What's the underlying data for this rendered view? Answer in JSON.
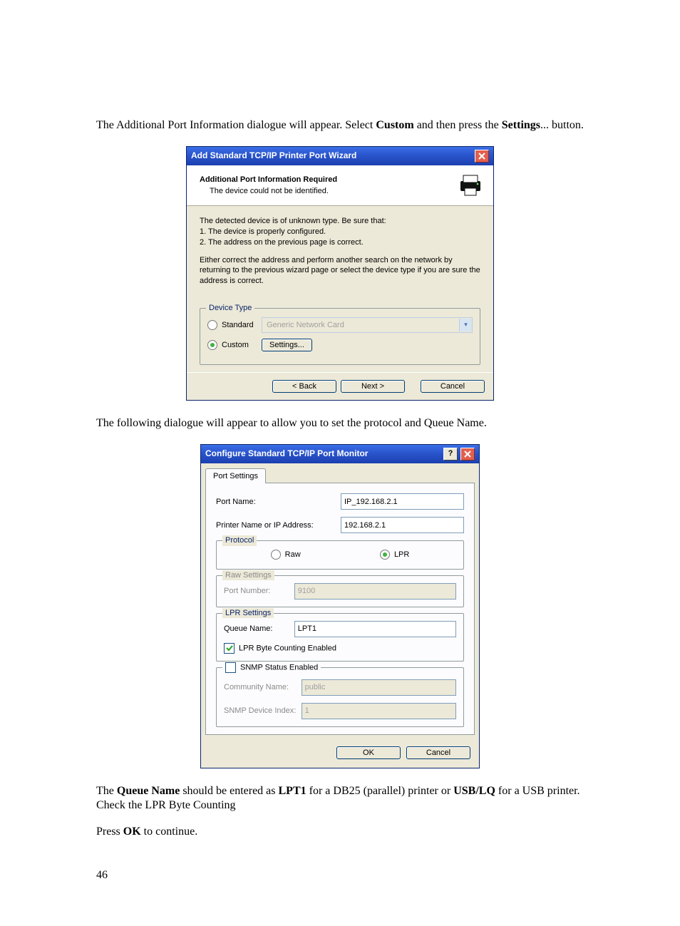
{
  "doc": {
    "line1a": "The Additional Port Information dialogue will appear. Select ",
    "line1b": "Custom",
    "line1c": " and then press the ",
    "line1d": "Settings",
    "line1e": "... button.",
    "line2": "The following dialogue will appear to allow you to set the protocol and Queue Name.",
    "line3a": "The ",
    "line3b": "Queue Name",
    "line3c": " should be entered as ",
    "line3d": "LPT1",
    "line3e": " for a DB25 (parallel) printer or ",
    "line3f": "USB/LQ",
    "line3g": " for a USB printer.",
    "line4": "Check the LPR Byte Counting",
    "line5a": "Press ",
    "line5b": "OK",
    "line5c": " to continue.",
    "page_number": "46"
  },
  "dlg1": {
    "title": "Add Standard TCP/IP Printer Port Wizard",
    "head_title": "Additional Port Information Required",
    "head_sub": "The device could not be identified.",
    "instr1": "The detected device is of unknown type.  Be sure that:",
    "instr2": "1.  The device is properly configured.",
    "instr3": "2.  The address on the previous page is correct.",
    "instr4": "Either correct the address and perform another search on the network by returning to the previous wizard page or select the device type if you are sure the address is correct.",
    "devtype_legend": "Device Type",
    "radio_standard": "Standard",
    "radio_custom": "Custom",
    "select_value": "Generic Network Card",
    "btn_settings": "Settings...",
    "btn_back": "< Back",
    "btn_next": "Next >",
    "btn_cancel": "Cancel"
  },
  "dlg2": {
    "title": "Configure Standard TCP/IP Port Monitor",
    "tab": "Port Settings",
    "lbl_portname": "Port Name:",
    "val_portname": "IP_192.168.2.1",
    "lbl_printer": "Printer Name or IP Address:",
    "val_printer": "192.168.2.1",
    "legend_protocol": "Protocol",
    "proto_raw": "Raw",
    "proto_lpr": "LPR",
    "legend_raw": "Raw Settings",
    "lbl_portnum": "Port Number:",
    "val_portnum": "9100",
    "legend_lpr": "LPR Settings",
    "lbl_queue": "Queue Name:",
    "val_queue": "LPT1",
    "chk_lprbyte": "LPR Byte Counting Enabled",
    "chk_snmp": "SNMP Status Enabled",
    "lbl_community": "Community Name:",
    "val_community": "public",
    "lbl_snmpidx": "SNMP Device Index:",
    "val_snmpidx": "1",
    "btn_ok": "OK",
    "btn_cancel": "Cancel"
  }
}
